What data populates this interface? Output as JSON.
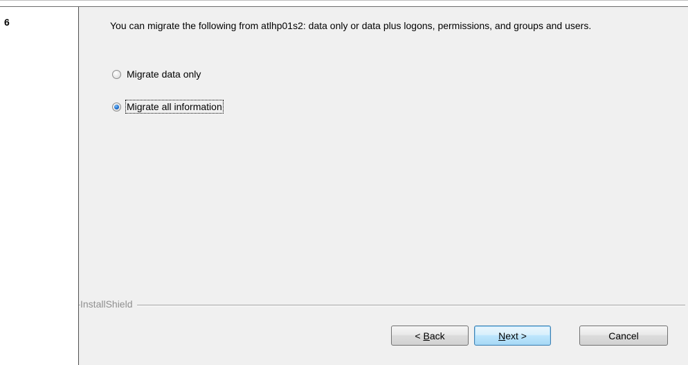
{
  "step": {
    "number": "6"
  },
  "dialog": {
    "message": "You can migrate the following from atlhp01s2: data only or data plus logons, permissions, and groups and users.",
    "options": [
      {
        "label": "Migrate data only",
        "checked": false
      },
      {
        "label": "Migrate all information",
        "checked": true
      }
    ],
    "brand": "InstallShield",
    "buttons": {
      "back": {
        "prefix": "< ",
        "mnemonic": "B",
        "rest": "ack"
      },
      "next": {
        "prefix": "",
        "mnemonic": "N",
        "rest": "ext >"
      },
      "cancel": {
        "label": "Cancel"
      }
    }
  }
}
